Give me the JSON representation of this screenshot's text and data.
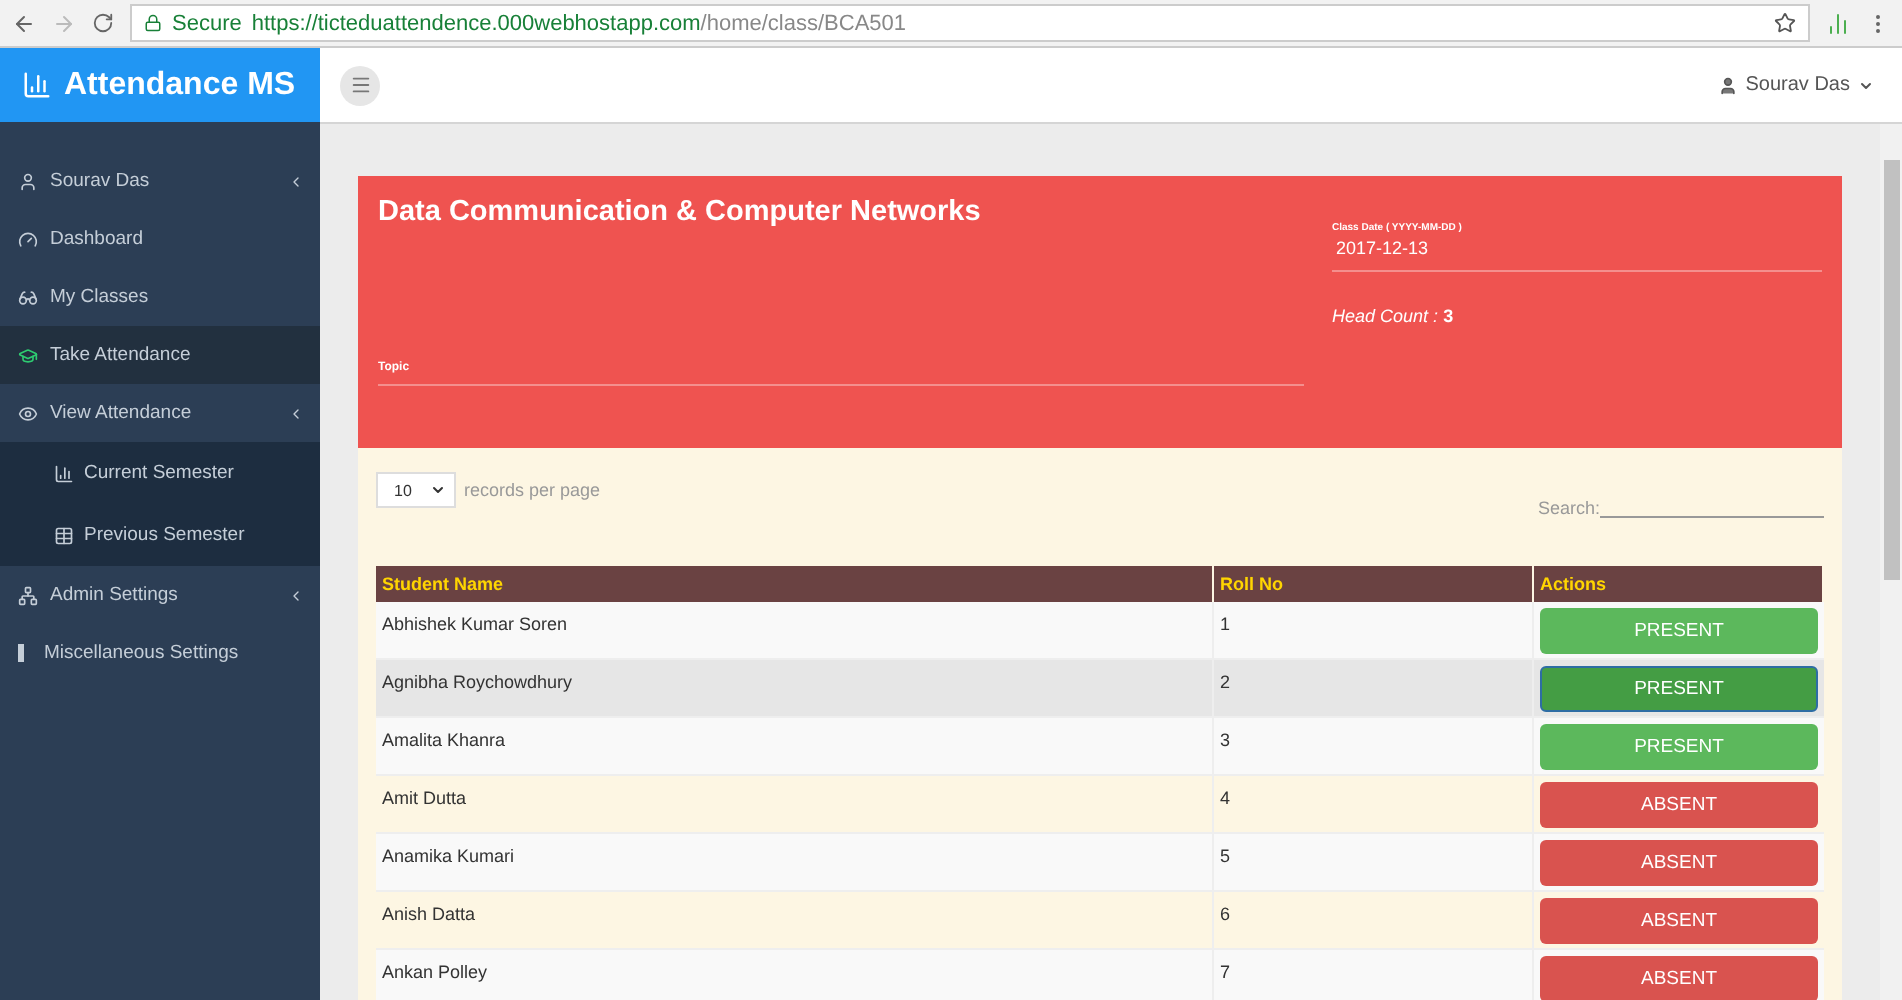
{
  "browser": {
    "secure_label": "Secure",
    "url_host": "https://ticteduattendence.000webhostapp.com",
    "url_path": "/home/class/BCA501"
  },
  "brand": "Attendance MS",
  "user_menu": "Sourav Das",
  "sidebar": {
    "items": [
      {
        "label": "Sourav Das",
        "selected": false,
        "has_caret": true
      },
      {
        "label": "Dashboard",
        "selected": false,
        "has_caret": false
      },
      {
        "label": "My Classes",
        "selected": false,
        "has_caret": false
      },
      {
        "label": "Take Attendance",
        "selected": true,
        "has_caret": false
      },
      {
        "label": "View Attendance",
        "selected": false,
        "has_caret": true,
        "children": [
          {
            "label": "Current Semester"
          },
          {
            "label": "Previous Semester"
          }
        ]
      },
      {
        "label": "Admin Settings",
        "selected": false,
        "has_caret": true
      },
      {
        "label": "Miscellaneous Settings",
        "selected": false,
        "has_caret": false
      }
    ]
  },
  "class_card": {
    "title": "Data Communication & Computer Networks",
    "topic_label": "Topic",
    "date_label": "Class Date ( YYYY-MM-DD )",
    "date": "2017-12-13",
    "head_count_label": "Head Count :",
    "head_count": "3"
  },
  "table_controls": {
    "page_size": "10",
    "page_size_label": "records per page",
    "search_label": "Search:"
  },
  "table": {
    "columns": [
      "Student Name",
      "Roll No",
      "Actions"
    ],
    "rows": [
      {
        "name": "Abhishek Kumar Soren",
        "roll": "1",
        "status": "PRESENT",
        "kind": "present",
        "focused": false,
        "hovered": false
      },
      {
        "name": "Agnibha Roychowdhury",
        "roll": "2",
        "status": "PRESENT",
        "kind": "present",
        "focused": true,
        "hovered": true
      },
      {
        "name": "Amalita Khanra",
        "roll": "3",
        "status": "PRESENT",
        "kind": "present",
        "focused": false,
        "hovered": false
      },
      {
        "name": "Amit Dutta",
        "roll": "4",
        "status": "ABSENT",
        "kind": "absent",
        "focused": false,
        "hovered": false
      },
      {
        "name": "Anamika Kumari",
        "roll": "5",
        "status": "ABSENT",
        "kind": "absent",
        "focused": false,
        "hovered": false
      },
      {
        "name": "Anish Datta",
        "roll": "6",
        "status": "ABSENT",
        "kind": "absent",
        "focused": false,
        "hovered": false
      },
      {
        "name": "Ankan Polley",
        "roll": "7",
        "status": "ABSENT",
        "kind": "absent",
        "focused": false,
        "hovered": false
      }
    ]
  }
}
